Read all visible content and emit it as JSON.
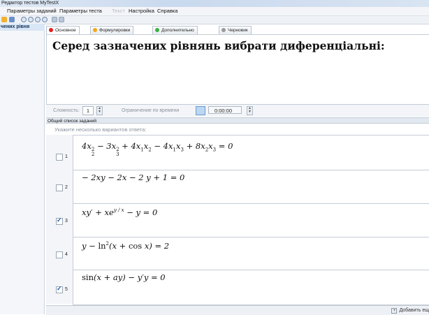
{
  "window": {
    "title": "Редактор тестов MyTestX"
  },
  "menu": [
    {
      "label": "Параметры заданий",
      "disabled": false
    },
    {
      "label": "Параметры теста",
      "disabled": false
    },
    {
      "label": "Текст",
      "disabled": true
    },
    {
      "label": "Настройка",
      "disabled": false
    },
    {
      "label": "Справка",
      "disabled": false
    }
  ],
  "sidebar": {
    "selected_item": "чених рівня"
  },
  "tabs": [
    {
      "label": "Основное",
      "color": "#e02020",
      "active": true
    },
    {
      "label": "Формулировки",
      "color": "#f2a81d",
      "active": false
    },
    {
      "label": "Дополнительно",
      "color": "#3cb043",
      "active": false
    },
    {
      "label": "Черновик",
      "color": "#9a9a9a",
      "active": false
    }
  ],
  "question": {
    "text": "Серед зазначених рівнянь вибрати диференціальні:"
  },
  "params": {
    "difficulty_label": "Сложность:",
    "difficulty_value": "1",
    "time_limit_label": "Ограничение по времени",
    "time_value": "0:00:00"
  },
  "answer_section": {
    "title": "Общий список заданий",
    "hint": "Укажите несколько вариантов ответа:"
  },
  "answers": [
    {
      "num": "1",
      "checked": false
    },
    {
      "num": "2",
      "checked": false
    },
    {
      "num": "3",
      "checked": true
    },
    {
      "num": "4",
      "checked": false
    },
    {
      "num": "5",
      "checked": true
    }
  ],
  "add_button": {
    "label": "Добавить ещ"
  },
  "colors": {
    "accent": "#1d5aa8",
    "panel": "#f3f5f8",
    "border": "#c4ccd6"
  }
}
